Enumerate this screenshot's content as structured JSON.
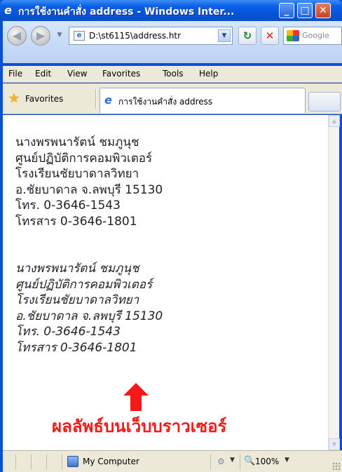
{
  "window": {
    "title": "การใช้งานคำสั่ง address - Windows Inter...",
    "minimize": "_",
    "maximize": "□",
    "close": "✕"
  },
  "address_bar": {
    "url": "D:\\st6115\\address.htr",
    "search_placeholder": "Google",
    "back_icon": "back-arrow-icon",
    "forward_icon": "forward-arrow-icon"
  },
  "menu": {
    "items": [
      "File",
      "Edit",
      "View",
      "Favorites",
      "Tools",
      "Help"
    ]
  },
  "favorites_bar": {
    "favorites_label": "Favorites",
    "tab_title": "การใช้งานคำสั่ง address"
  },
  "content": {
    "normal_block": [
      "นางพรพนารัตน์ ชมภูนุช",
      "ศูนย์ปฏิบัติการคอมพิวเตอร์",
      "โรงเรียนชัยบาดาลวิทยา",
      "อ.ชัยบาดาล จ.ลพบุรี 15130",
      "โทร. 0-3646-1543",
      "โทรสาร 0-3646-1801"
    ],
    "italic_block": [
      "นางพรพนารัตน์ ชมภูนุช",
      "ศูนย์ปฏิบัติการคอมพิวเตอร์",
      "โรงเรียนชัยบาดาลวิทยา",
      "อ.ชัยบาดาล จ.ลพบุรี 15130",
      "โทร. 0-3646-1543",
      "โทรสาร 0-3646-1801"
    ],
    "annotation": "ผลลัพธ์บนเว็บบราวเซอร์",
    "annotation_color": "#f51a1a"
  },
  "status_bar": {
    "zone": "My Computer",
    "zoom": "100%"
  },
  "colors": {
    "titlebar": "#0a5fe6",
    "chrome": "#ece9d8"
  }
}
